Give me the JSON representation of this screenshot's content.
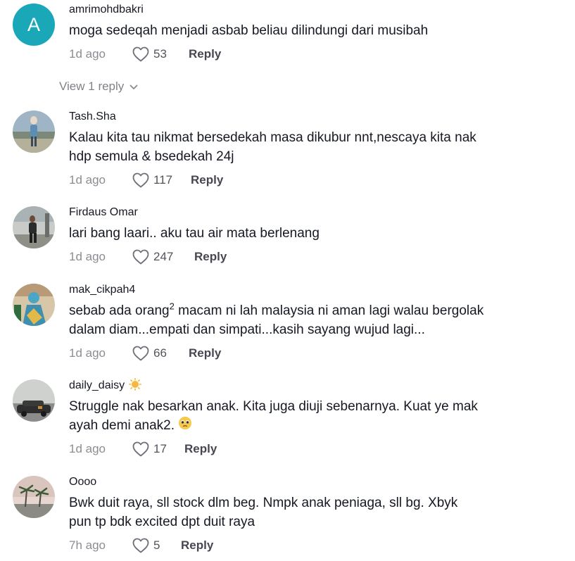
{
  "comments": [
    {
      "username": "amrimohdbakri",
      "avatar_letter": "A",
      "text": "moga sedeqah menjadi asbab beliau dilindungi dari musibah",
      "time": "1d ago",
      "likes": "53",
      "reply_label": "Reply",
      "view_replies": "View 1 reply"
    },
    {
      "username": "Tash.Sha",
      "text_line1": "Kalau kita tau nikmat bersedekah masa dikubur nnt,nescaya kita nak",
      "text_line2": "hdp semula & bsedekah 24j",
      "time": "1d ago",
      "likes": "117",
      "reply_label": "Reply"
    },
    {
      "username": "Firdaus Omar",
      "text": "lari bang laari.. aku tau air mata berlenang",
      "time": "1d ago",
      "likes": "247",
      "reply_label": "Reply"
    },
    {
      "username": "mak_cikpah4",
      "text_part1": "sebab ada orang",
      "text_sup": "2",
      "text_part2": " macam ni lah malaysia ni aman lagi walau bergolak",
      "text_line2": "dalam diam...empati dan simpati...kasih sayang wujud lagi...",
      "time": "1d ago",
      "likes": "66",
      "reply_label": "Reply"
    },
    {
      "username": "daily_daisy",
      "username_emoji": "sun-emoji",
      "text_line1": "Struggle nak besarkan anak. Kita juga diuji sebenarnya. Kuat ye mak",
      "text_line2": "ayah demi anak2.",
      "text_emoji": "pleading-face-emoji",
      "time": "1d ago",
      "likes": "17",
      "reply_label": "Reply"
    },
    {
      "username": "Oooo",
      "text_line1": "Bwk duit raya, sll stock dlm beg. Nmpk anak peniaga, sll bg. Xbyk",
      "text_line2": "pun tp bdk excited dpt duit raya",
      "time": "7h ago",
      "likes": "5",
      "reply_label": "Reply"
    }
  ],
  "colors": {
    "avatar_letter_bg": "#1aa8b8",
    "text": "#161823",
    "muted": "rgba(22,24,35,0.5)"
  }
}
